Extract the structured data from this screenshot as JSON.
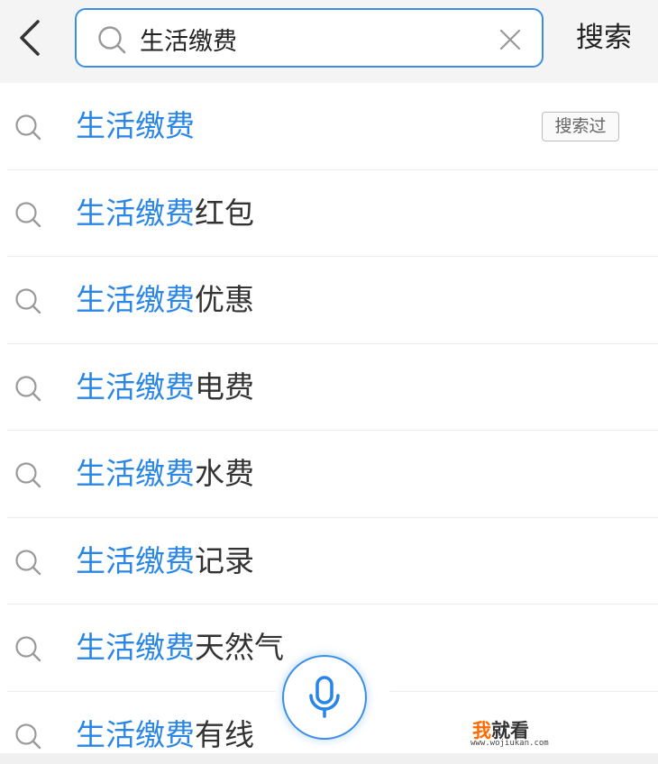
{
  "header": {
    "search_value": "生活缴费",
    "submit_label": "搜索"
  },
  "suggestions": [
    {
      "highlight": "生活缴费",
      "rest": "",
      "badge": "搜索过"
    },
    {
      "highlight": "生活缴费",
      "rest": "红包"
    },
    {
      "highlight": "生活缴费",
      "rest": "优惠"
    },
    {
      "highlight": "生活缴费",
      "rest": "电费"
    },
    {
      "highlight": "生活缴费",
      "rest": "水费"
    },
    {
      "highlight": "生活缴费",
      "rest": "记录"
    },
    {
      "highlight": "生活缴费",
      "rest": "天然气"
    },
    {
      "highlight": "生活缴费",
      "rest": "有线"
    }
  ],
  "watermark": {
    "part1": "我",
    "part2": "就看",
    "site": "www.wojiukan.com"
  },
  "colors": {
    "accent": "#3a8ee6",
    "highlight_text": "#2a86e6",
    "header_bg": "#f4f4f4"
  },
  "icons": [
    "back-arrow-icon",
    "search-icon",
    "clear-icon",
    "microphone-icon"
  ]
}
